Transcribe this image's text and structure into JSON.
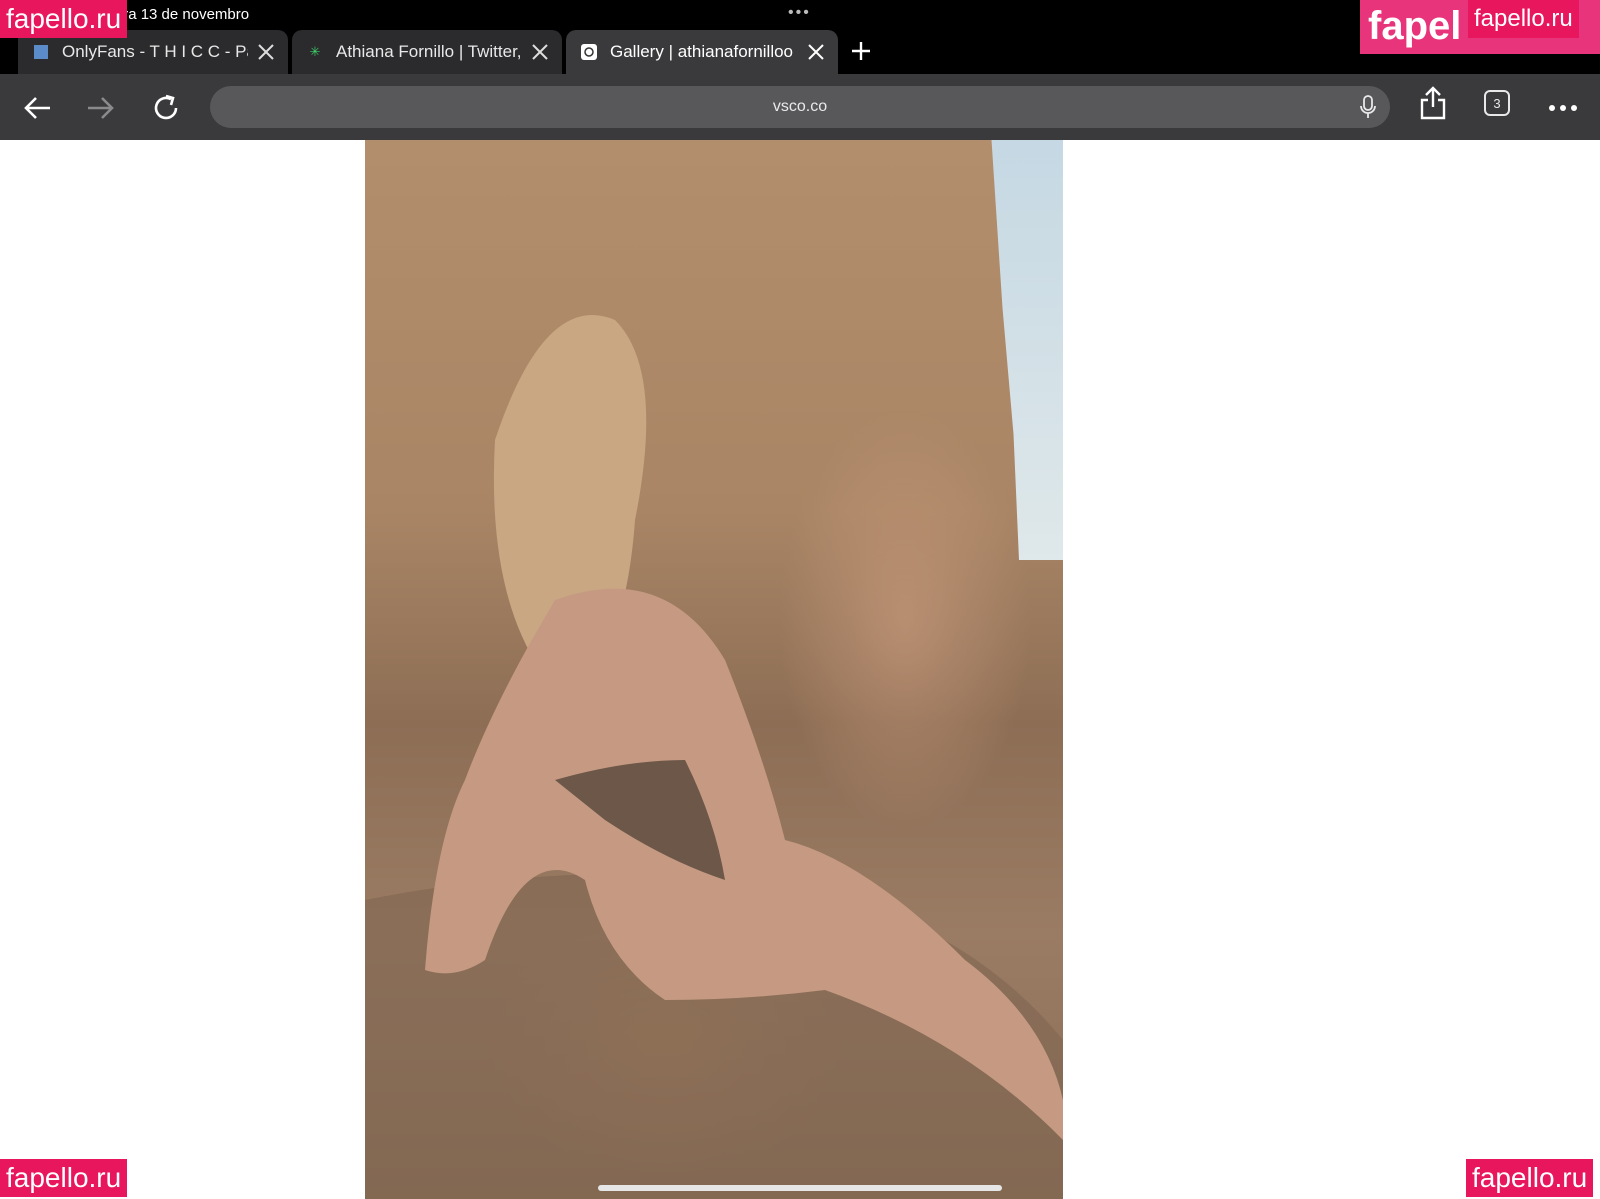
{
  "status_bar": {
    "date": "Sexta-feira 13 de novembro",
    "dots": "•••"
  },
  "tabs": [
    {
      "title": "OnlyFans - T H I C C - Pa",
      "favicon": "onlyfans-icon",
      "active": false
    },
    {
      "title": "Athiana Fornillo | Twitter,",
      "favicon": "sparkle-icon",
      "active": false
    },
    {
      "title": "Gallery | athianafornilloo",
      "favicon": "vsco-icon",
      "active": true
    }
  ],
  "toolbar": {
    "url": "vsco.co",
    "tab_count": "3"
  },
  "watermarks": {
    "top_left": "fapello.ru",
    "top_right_logo": "fapel",
    "top_right": "fapello.ru",
    "bottom_left": "fapello.ru",
    "bottom_right": "fapello.ru"
  },
  "colors": {
    "chrome_bg": "#000000",
    "toolbar_bg": "#3a3a3c",
    "address_bg": "#58585b",
    "watermark": "#e8175d"
  }
}
